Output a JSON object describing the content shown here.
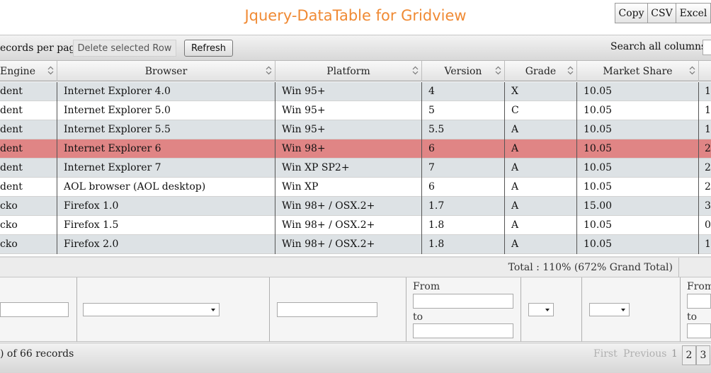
{
  "page": {
    "title": "Jquery-DataTable for Gridview"
  },
  "table_tools": {
    "copy": "Copy",
    "csv": "CSV",
    "excel": "Excel"
  },
  "toolbar": {
    "records_per_page": "ecords per page",
    "delete_button": "Delete selected Row",
    "refresh_button": "Refresh",
    "search_label": "Search all columns:"
  },
  "table": {
    "headers": [
      "Engine",
      "Browser",
      "Platform",
      "Version",
      "Grade",
      "Market Share",
      ""
    ],
    "rows": [
      {
        "engine": "dent",
        "browser": "Internet Explorer 4.0",
        "platform": "Win 95+",
        "version": "4",
        "grade": "X",
        "share": "10.05",
        "extra": "1",
        "highlight": false
      },
      {
        "engine": "dent",
        "browser": "Internet Explorer 5.0",
        "platform": "Win 95+",
        "version": "5",
        "grade": "C",
        "share": "10.05",
        "extra": "1",
        "highlight": false
      },
      {
        "engine": "dent",
        "browser": "Internet Explorer 5.5",
        "platform": "Win 95+",
        "version": "5.5",
        "grade": "A",
        "share": "10.05",
        "extra": "1",
        "highlight": false
      },
      {
        "engine": "dent",
        "browser": "Internet Explorer 6",
        "platform": "Win 98+",
        "version": "6",
        "grade": "A",
        "share": "10.05",
        "extra": "2",
        "highlight": true
      },
      {
        "engine": "dent",
        "browser": "Internet Explorer 7",
        "platform": "Win XP SP2+",
        "version": "7",
        "grade": "A",
        "share": "10.05",
        "extra": "2",
        "highlight": false
      },
      {
        "engine": "dent",
        "browser": "AOL browser (AOL desktop)",
        "platform": "Win XP",
        "version": "6",
        "grade": "A",
        "share": "10.05",
        "extra": "2",
        "highlight": false
      },
      {
        "engine": "cko",
        "browser": "Firefox 1.0",
        "platform": "Win 98+ / OSX.2+",
        "version": "1.7",
        "grade": "A",
        "share": "15.00",
        "extra": "3",
        "highlight": false
      },
      {
        "engine": "cko",
        "browser": "Firefox 1.5",
        "platform": "Win 98+ / OSX.2+",
        "version": "1.8",
        "grade": "A",
        "share": "10.05",
        "extra": "0",
        "highlight": false
      },
      {
        "engine": "cko",
        "browser": "Firefox 2.0",
        "platform": "Win 98+ / OSX.2+",
        "version": "1.8",
        "grade": "A",
        "share": "10.05",
        "extra": "1",
        "highlight": false
      }
    ],
    "total": "Total : 110% (672% Grand Total)"
  },
  "filters": {
    "from_label": "From",
    "to_label": "to",
    "from_label_2": "From",
    "to_label_2": "to"
  },
  "footer": {
    "info": ") of 66 records",
    "first": "First",
    "previous": "Previous",
    "pages": [
      "1",
      "2",
      "3"
    ]
  },
  "colors": {
    "title": "#f08a34",
    "row_odd": "#dde2e5",
    "row_even": "#ffffff",
    "row_selected": "#e08585"
  }
}
